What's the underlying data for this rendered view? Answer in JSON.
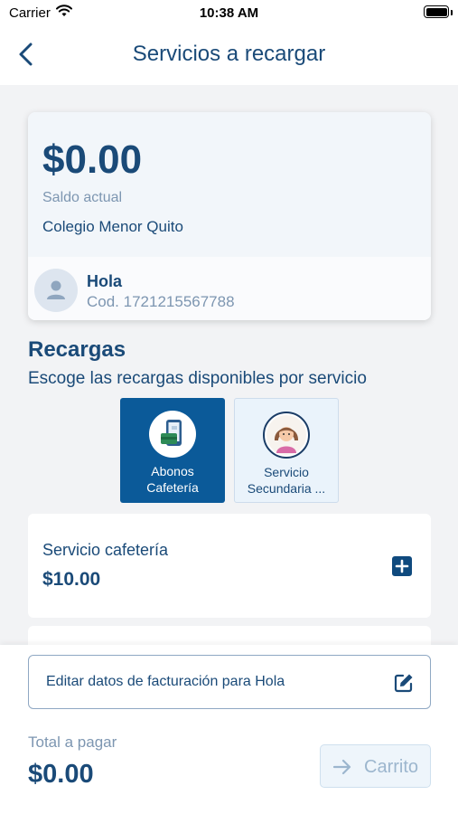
{
  "status_bar": {
    "carrier": "Carrier",
    "time": "10:38 AM"
  },
  "nav": {
    "title": "Servicios a recargar",
    "back_icon": "chevron-left-icon"
  },
  "balance": {
    "amount": "$0.00",
    "label": "Saldo actual",
    "school": "Colegio Menor Quito",
    "user_name": "Hola",
    "user_code": "Cod. 1721215567788"
  },
  "recargas": {
    "title": "Recargas",
    "subtitle": "Escoge las recargas disponibles por servicio",
    "services": [
      {
        "line1": "Abonos",
        "line2": "Cafetería",
        "icon": "phone-wallet-icon",
        "selected": true
      },
      {
        "line1": "Servicio",
        "line2": "Secundaria ...",
        "icon": "student-avatar-icon",
        "selected": false
      }
    ],
    "items": [
      {
        "name": "Servicio cafetería",
        "price": "$10.00",
        "action_icon": "plus-icon"
      }
    ]
  },
  "footer": {
    "billing_label": "Editar datos de facturación para Hola",
    "billing_icon": "edit-icon",
    "total_label": "Total a pagar",
    "total_amount": "$0.00",
    "cart_label": "Carrito",
    "cart_icon": "arrow-right-icon"
  },
  "colors": {
    "primary": "#1a4a78",
    "selected_tile": "#0b5a99",
    "muted": "#7d96b1",
    "background": "#f2f3f5"
  }
}
